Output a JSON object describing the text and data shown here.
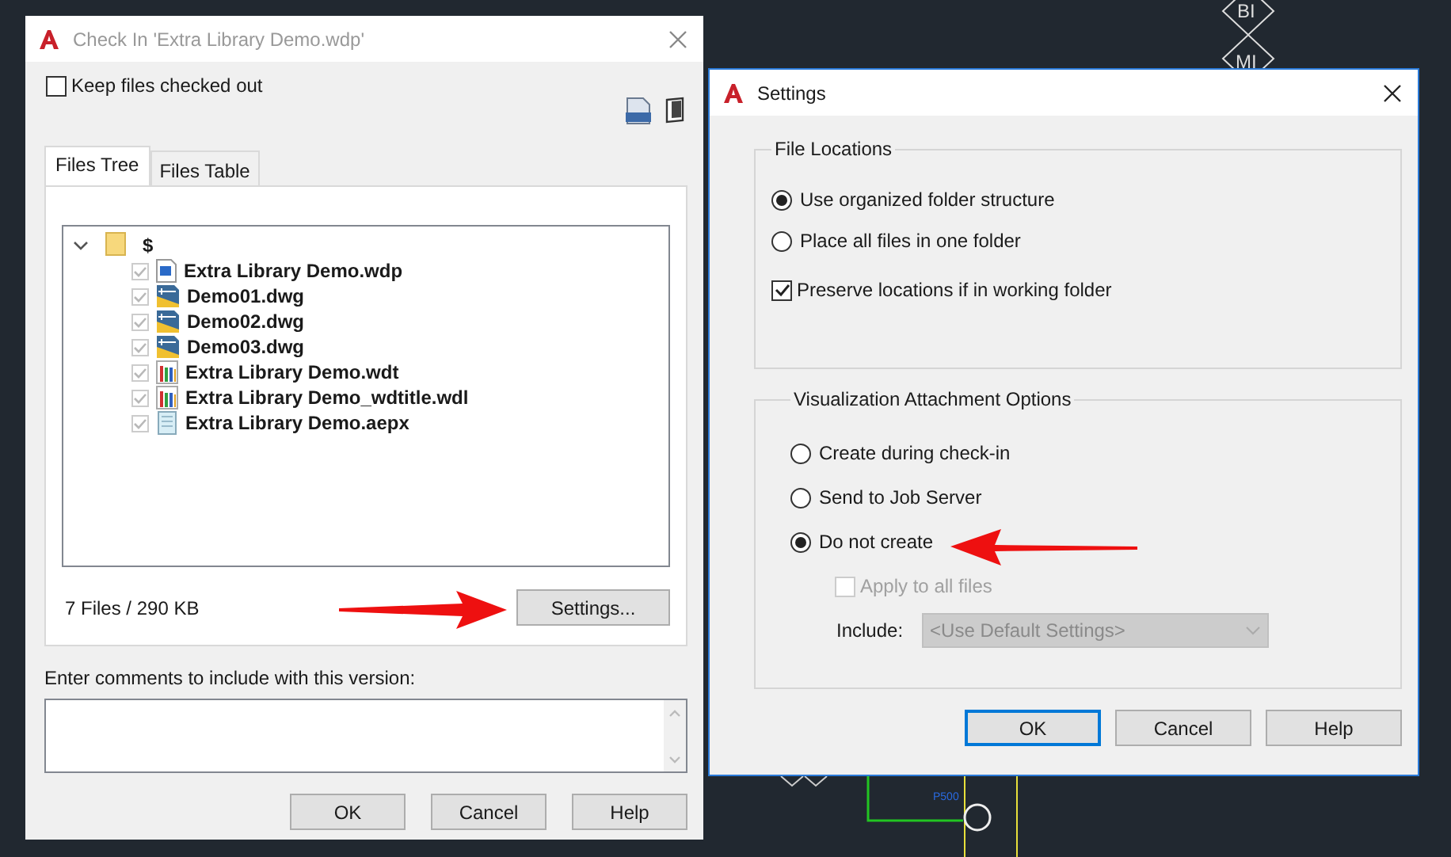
{
  "canvas": {
    "labels": [
      {
        "text": "BI"
      },
      {
        "text": "MI"
      },
      {
        "text": "P500"
      }
    ]
  },
  "checkin_dialog": {
    "title": "Check In 'Extra Library Demo.wdp'",
    "keep_checked_out": {
      "label": "Keep files checked out",
      "checked": false
    },
    "tabs": [
      {
        "label": "Files Tree",
        "selected": true
      },
      {
        "label": "Files Table",
        "selected": false
      }
    ],
    "tree": {
      "label": "$",
      "expanded": true,
      "children": [
        {
          "name": "Extra Library Demo.wdp",
          "kind": "project",
          "checked": true
        },
        {
          "name": "Demo01.dwg",
          "kind": "drawing",
          "checked": true
        },
        {
          "name": "Demo02.dwg",
          "kind": "drawing",
          "checked": true
        },
        {
          "name": "Demo03.dwg",
          "kind": "drawing",
          "checked": true
        },
        {
          "name": "Extra Library Demo.wdt",
          "kind": "library",
          "checked": true
        },
        {
          "name": "Extra Library Demo_wdtitle.wdl",
          "kind": "library",
          "checked": true
        },
        {
          "name": "Extra Library Demo.aepx",
          "kind": "notes",
          "checked": true
        }
      ]
    },
    "summary": "7 Files / 290 KB",
    "settings_button": "Settings...",
    "comments_label": "Enter comments to include with this version:",
    "buttons": [
      "OK",
      "Cancel",
      "Help"
    ]
  },
  "settings_dialog": {
    "title": "Settings",
    "file_locations": {
      "title": "File Locations",
      "options": [
        {
          "label": "Use organized folder structure",
          "selected": true
        },
        {
          "label": "Place all files in one folder",
          "selected": false
        }
      ],
      "preserve": {
        "label": "Preserve locations if in working folder",
        "checked": true
      }
    },
    "visualization": {
      "title": "Visualization Attachment Options",
      "options": [
        {
          "label": "Create during check-in",
          "selected": false
        },
        {
          "label": "Send to Job Server",
          "selected": false
        },
        {
          "label": "Do not create",
          "selected": true
        }
      ],
      "apply_all": {
        "label": "Apply to all files",
        "checked": false,
        "disabled": true
      },
      "include": {
        "label": "Include:",
        "value": "<Use Default Settings>",
        "disabled": true
      }
    },
    "buttons": [
      {
        "label": "OK",
        "default": true
      },
      {
        "label": "Cancel",
        "default": false
      },
      {
        "label": "Help",
        "default": false
      }
    ]
  }
}
